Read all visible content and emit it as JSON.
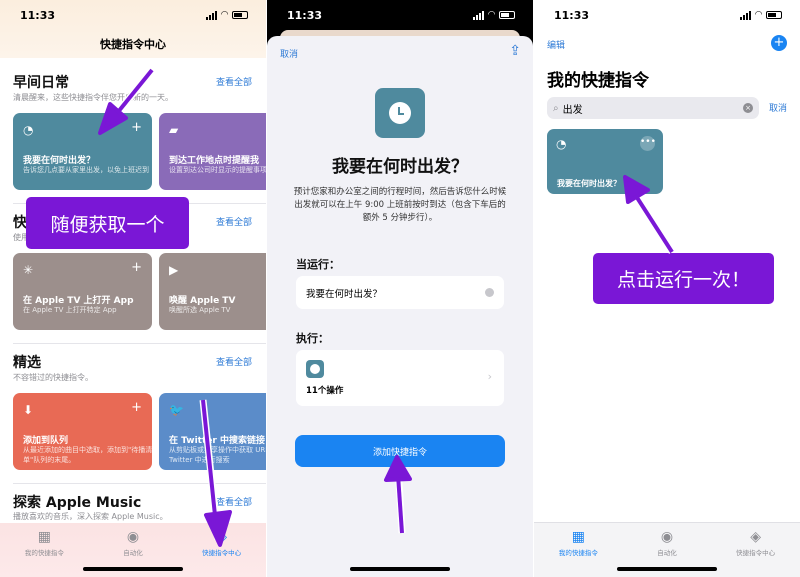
{
  "status": {
    "time": "11:33"
  },
  "panel1": {
    "title": "快捷指令中心",
    "sections": [
      {
        "title": "早间日常",
        "subtitle": "清晨醒来，这些快捷指令伴您开启新的一天。",
        "see_all": "查看全部",
        "cards": [
          {
            "title": "我要在何时出发？",
            "subtitle": "告诉您几点要从家里出发，以免上班迟到",
            "icon": "clock-icon",
            "color": "#4f8a9e"
          },
          {
            "title": "到达工作地点时提醒我",
            "subtitle": "设置到达公司时显示的提醒事项",
            "icon": "briefcase-icon",
            "color": "#8a6bb8"
          }
        ]
      },
      {
        "title": "快捷",
        "subtitle": "使用",
        "see_all": "查看全部",
        "cards": [
          {
            "title": "在 Apple TV 上打开 App",
            "subtitle": "在 Apple TV 上打开特定 App",
            "icon": "loading-icon",
            "color": "#9c8f8c"
          },
          {
            "title": "唤醒 Apple TV",
            "subtitle": "唤醒所选 Apple TV",
            "icon": "play-icon",
            "color": "#9c8f8c"
          }
        ]
      },
      {
        "title": "精选",
        "subtitle": "不容错过的快捷指令。",
        "see_all": "查看全部",
        "cards": [
          {
            "title": "添加到队列",
            "subtitle": "从最近添加的曲目中选取，添加到\"待播清单\"队列的末尾。",
            "icon": "download-icon",
            "color": "#e86a55"
          },
          {
            "title": "在 Twitter 中搜索链接",
            "subtitle": "从剪贴板或共享操作中获取 URL，然后在 Twitter 中进行搜索",
            "icon": "twitter-icon",
            "color": "#5b8cc9"
          }
        ]
      },
      {
        "title": "探索 Apple Music",
        "subtitle": "播放喜欢的音乐，深入探索 Apple Music。",
        "see_all": "查看全部"
      }
    ],
    "overlay_label": "随便获取一个",
    "tabs": [
      {
        "label": "我的快捷指令",
        "active": false
      },
      {
        "label": "自动化",
        "active": false
      },
      {
        "label": "快捷指令中心",
        "active": true
      }
    ]
  },
  "panel2": {
    "cancel": "取消",
    "title": "我要在何时出发？",
    "description": "预计您家和办公室之间的行程时间，然后告诉您什么时候出发就可以在上午 9:00 上班前按时到达（包含下车后的额外 5 分钟步行）。",
    "when_run_label": "当运行：",
    "phrase_value": "我要在何时出发？",
    "do_label": "执行：",
    "actions_count": "11个操作",
    "add_button": "添加快捷指令"
  },
  "panel3": {
    "edit": "编辑",
    "title": "我的快捷指令",
    "search_value": "出发",
    "search_cancel": "取消",
    "result_card": {
      "title": "我要在何时出发？",
      "color": "#4f8a9e"
    },
    "overlay_label": "点击运行一次！",
    "tabs": [
      {
        "label": "我的快捷指令",
        "active": true
      },
      {
        "label": "自动化",
        "active": false
      },
      {
        "label": "快捷指令中心",
        "active": false
      }
    ]
  },
  "colors": {
    "accent": "#1a84f2",
    "annotation": "#7a17d6"
  }
}
